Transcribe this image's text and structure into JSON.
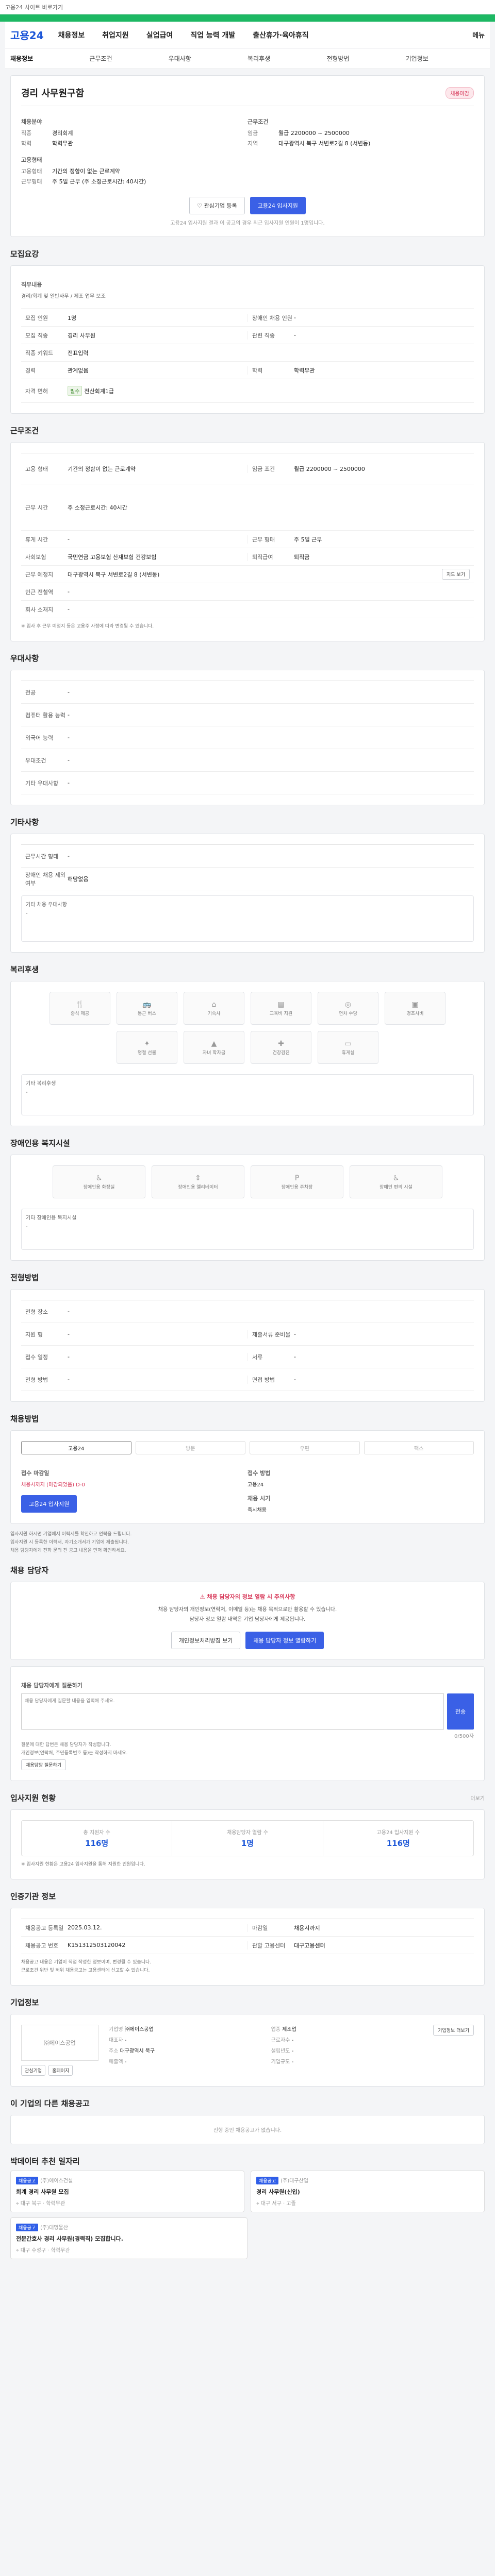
{
  "topbar": {
    "notice": "고용24 사이트 바로가기"
  },
  "gnb": {
    "logo": "고용24",
    "items": [
      "채용정보",
      "취업지원",
      "실업급여",
      "직업 능력 개발",
      "출산휴가·육아휴직"
    ],
    "right": "메뉴"
  },
  "tabs": [
    "채용정보",
    "근무조건",
    "우대사항",
    "복리후생",
    "전형방법",
    "기업정보"
  ],
  "job": {
    "title": "경리 사무원구함",
    "badge": "채용마감",
    "recruit_section": "채용분야",
    "recruit_rows": [
      {
        "k": "직종",
        "v": "경리회계"
      },
      {
        "k": "학력",
        "v": "학력무관"
      }
    ],
    "cond_section": "근무조건",
    "cond_rows": [
      {
        "k": "임금",
        "v": "월급 2200000 ~ 2500000"
      },
      {
        "k": "지역",
        "v": "대구광역시 북구 서변로2길 8 (서변동)"
      }
    ],
    "type_section": "고용형태",
    "type_rows": [
      {
        "k": "고용형태",
        "v": "기간의 정함이 없는 근로계약"
      },
      {
        "k": "근무형태",
        "v": "주 5일 근무 (주 소정근로시간: 40시간)"
      }
    ],
    "btn_interest": "관심기업 등록",
    "btn_apply": "고용24 입사지원",
    "apply_note": "고용24 입사지원 결과 이 공고의 경우 최근 입사지원 인원이 1명입니다."
  },
  "sections": {
    "recruit": "모집요강",
    "work": "근무조건",
    "pref": "우대사항",
    "etc": "기타사항",
    "welfare": "복리후생",
    "disabled": "장애인용 복지시설",
    "selection": "전형방법",
    "method": "채용방법",
    "contact": "채용 담당자",
    "apply_status": "입사지원 현황",
    "info": "인증기관 정보",
    "company": "기업정보",
    "other_jobs": "이 기업의 다른 채용공고",
    "similar": "박데이터 추천 일자리"
  },
  "recruit": {
    "duty_label": "직무내용",
    "duty_text": "경리/회계 및 일반사무 / 제조 업무 보조",
    "rows": [
      {
        "k": "모집 인원",
        "v": "1명",
        "k2": "장애인 채용 인원",
        "v2": "-"
      },
      {
        "k": "모집 직종",
        "v": "경리 사무원",
        "k2": "관련 직종",
        "v2": "-"
      },
      {
        "k": "직종 키워드",
        "v": "전표입력",
        "k2": "",
        "v2": ""
      },
      {
        "k": "경력",
        "v": "관계없음",
        "k2": "학력",
        "v2": "학력무관"
      },
      {
        "k": "자격 면허",
        "v": "전산회계1급",
        "k2": "",
        "v2": ""
      }
    ]
  },
  "work": {
    "rows": [
      {
        "k": "고용 형태",
        "v": "기간의 정함이 없는 근로계약",
        "k2": "임금 조건",
        "v2": "월급 2200000 ~ 2500000"
      },
      {
        "k": "근무 시간",
        "v": "주 소정근로시간: 40시간",
        "k2": "",
        "v2": ""
      },
      {
        "k": "휴게 시간",
        "v": "-",
        "k2": "근무 형태",
        "v2": "주 5일 근무"
      },
      {
        "k": "사회보험",
        "v": "국민연금 고용보험 산재보험 건강보험",
        "k2": "퇴직급여",
        "v2": "퇴직금"
      },
      {
        "k": "근무 예정지",
        "v": "대구광역시 북구 서변로2길 8 (서변동)",
        "k2": "",
        "v2": ""
      },
      {
        "k": "인근 전철역",
        "v": "-",
        "k2": "",
        "v2": ""
      },
      {
        "k": "회사 소재지",
        "v": "-",
        "k2": "",
        "v2": ""
      }
    ],
    "map_btn": "지도 보기",
    "note": "※ 입사 후 근무 예정지 등은 고용주 사정에 따라 변경될 수 있습니다."
  },
  "pref": {
    "rows": [
      {
        "k": "전공",
        "v": "-"
      },
      {
        "k": "컴퓨터 활용 능력",
        "v": "-"
      },
      {
        "k": "외국어 능력",
        "v": "-"
      },
      {
        "k": "우대조건",
        "v": "-"
      },
      {
        "k": "기타 우대사항",
        "v": "-"
      }
    ]
  },
  "etc": {
    "rows": [
      {
        "k": "근무시간 형태",
        "v": "-"
      },
      {
        "k": "장애인 채용 제외 여부",
        "v": "해당없음"
      }
    ],
    "extra_label": "기타 채용 우대사항",
    "extra_value": "-"
  },
  "welfare": {
    "items": [
      "중식 제공",
      "통근 버스",
      "기숙사",
      "교육비 지원",
      "연차 수당",
      "경조사비",
      "명절 선물",
      "자녀 학자금",
      "건강검진",
      "휴게실"
    ],
    "extra_label": "기타 복리후생",
    "extra_value": "-"
  },
  "disabled": {
    "items": [
      "장애인용 화장실",
      "장애인용 엘리베이터",
      "장애인용 주차장",
      "장애인 편의 시설"
    ],
    "extra_label": "기타 장애인용 복지시설",
    "extra_value": "-"
  },
  "selection": {
    "rows": [
      {
        "k": "전형 장소",
        "v": "-",
        "k2": "",
        "v2": ""
      },
      {
        "k": "지원 형",
        "v": "-",
        "k2": "제출서류 준비물",
        "v2": "-"
      },
      {
        "k": "접수 일정",
        "v": "-",
        "k2": "서류",
        "v2": "-"
      },
      {
        "k": "전형 방법",
        "v": "-",
        "k2": "면접 방법",
        "v2": "-"
      }
    ]
  },
  "method": {
    "tabs": [
      "고용24",
      "방문",
      "우편",
      "팩스"
    ],
    "apply_label": "접수 마감일",
    "apply_value": "채용시까지 (마감되었음) D-0",
    "process_label": "접수 방법",
    "process_value": "고용24",
    "result_label": "채용 시기",
    "result_value": "즉시채용",
    "apply_btn": "고용24 입사지원",
    "bullets": [
      "입사지원 하시면 기업에서 이력서를 확인하고 연락을 드립니다.",
      "입사지원 시 등록한 이력서, 자기소개서가 기업에 제출됩니다.",
      "채용 담당자에게 전화 문의 전 공고 내용을 먼저 확인하세요."
    ]
  },
  "contact": {
    "warning": "채용 담당자의 정보 열람 시 주의사항",
    "line1": "채용 담당자의 개인정보(연락처, 이메일 등)는 채용 목적으로만 활용할 수 있습니다.",
    "line2": "담당자 정보 열람 내역은 기업 담당자에게 제공됩니다.",
    "btn1": "개인정보처리방침 보기",
    "btn2": "채용 담당자 정보 열람하기",
    "ask_label": "채용 담당자에게 질문하기",
    "ask_placeholder": "채용 담당자에게 질문할 내용을 입력해 주세요.",
    "ask_count": "0/500자",
    "ask_btn": "전송",
    "bullets": [
      "질문에 대한 답변은 채용 담당자가 작성합니다.",
      "개인정보(연락처, 주민등록번호 등)는 작성하지 마세요."
    ],
    "dev_btn": "채용담당 질문하기"
  },
  "apply_status": {
    "more": "더보기",
    "cells": [
      {
        "label": "총 지원자 수",
        "value": "116명"
      },
      {
        "label": "채용담당자 열람 수",
        "value": "1명"
      },
      {
        "label": "고용24 입사지원 수",
        "value": "116명"
      }
    ],
    "note": "※ 입사지원 현황은 고용24 입사지원을 통해 지원한 인원입니다."
  },
  "info": {
    "rows": [
      {
        "k": "채용공고 등록일",
        "v": "2025.03.12.",
        "k2": "마감일",
        "v2": "채용시까지"
      },
      {
        "k": "채용공고 번호",
        "v": "K151312503120042",
        "k2": "관할 고용센터",
        "v2": "대구고용센터"
      }
    ],
    "bullets": [
      "채용공고 내용은 기업이 직접 작성한 정보이며, 변경될 수 있습니다.",
      "근로조건 위반 및 허위 채용공고는 고용센터에 신고할 수 있습니다."
    ]
  },
  "company": {
    "name": "㈜에이스공업",
    "btn": "기업정보 더보기",
    "btn_interest": "관심기업",
    "btn_home": "홈페이지",
    "rows": [
      {
        "k": "기업명",
        "v": "㈜에이스공업",
        "k2": "업종",
        "v2": "제조업"
      },
      {
        "k": "대표자",
        "v": "-",
        "k2": "근로자수",
        "v2": "-"
      },
      {
        "k": "주소",
        "v": "대구광역시 북구",
        "k2": "설립년도",
        "v2": "-"
      },
      {
        "k": "매출액",
        "v": "-",
        "k2": "기업규모",
        "v2": "-"
      }
    ]
  },
  "other_jobs": {
    "empty": "진행 중인 채용공고가 없습니다."
  },
  "similar": {
    "cards": [
      {
        "tag": "채용공고",
        "company": "(주)에이스건설",
        "title": "회계 경리 사무원 모집",
        "loc": "대구 북구",
        "edu": "학력무관"
      },
      {
        "tag": "채용공고",
        "company": "(주)대구산업",
        "title": "경리 사무원(신입)",
        "loc": "대구 서구",
        "edu": "고졸"
      },
      {
        "tag": "채용공고",
        "company": "(주)대명물산",
        "title": "전문간호사 경리 사무원(경력직) 모집합니다.",
        "loc": "대구 수성구",
        "edu": "학력무관"
      }
    ]
  }
}
